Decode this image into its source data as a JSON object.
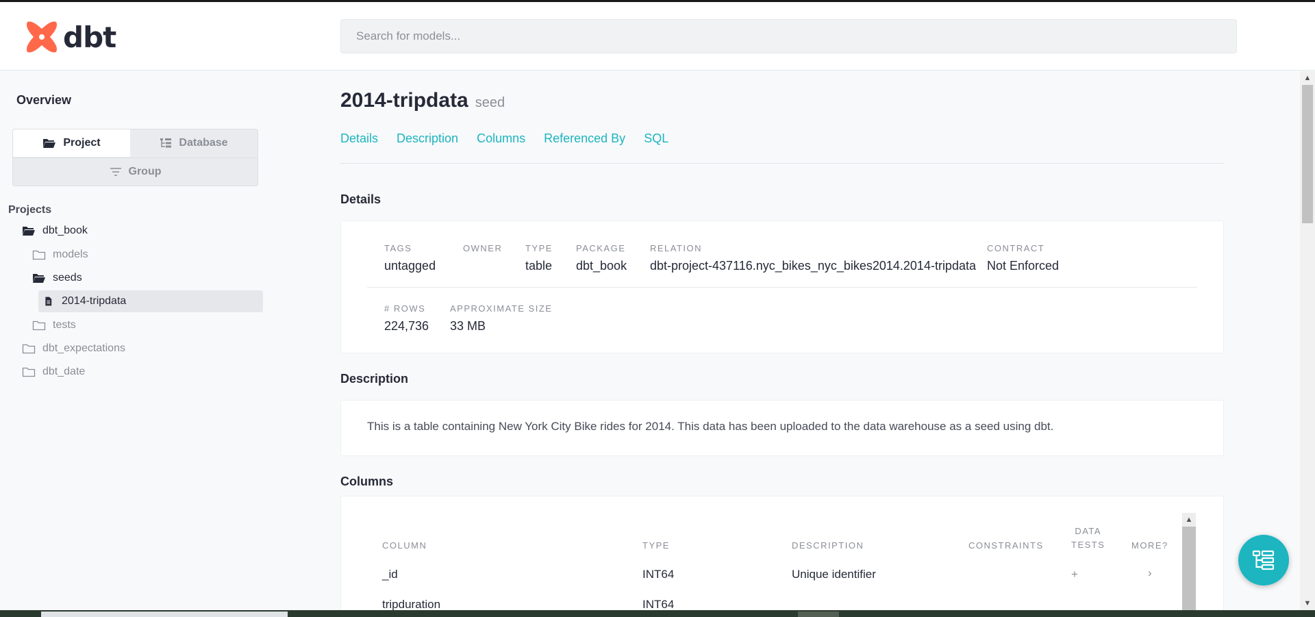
{
  "header": {
    "logo_text": "dbt",
    "search_placeholder": "Search for models..."
  },
  "sidebar": {
    "overview_label": "Overview",
    "segment": {
      "project_label": "Project",
      "database_label": "Database",
      "group_label": "Group"
    },
    "projects_label": "Projects",
    "tree": [
      {
        "label": "dbt_book",
        "level": 0,
        "state": "open"
      },
      {
        "label": "models",
        "level": 1,
        "state": "closed"
      },
      {
        "label": "seeds",
        "level": 1,
        "state": "open"
      },
      {
        "label": "2014-tripdata",
        "level": 2,
        "state": "file-active"
      },
      {
        "label": "tests",
        "level": 1,
        "state": "closed"
      },
      {
        "label": "dbt_expectations",
        "level": 0,
        "state": "closed"
      },
      {
        "label": "dbt_date",
        "level": 0,
        "state": "closed"
      }
    ]
  },
  "main": {
    "title": "2014-tripdata",
    "subtitle": "seed",
    "tabs": [
      "Details",
      "Description",
      "Columns",
      "Referenced By",
      "SQL"
    ],
    "details": {
      "heading": "Details",
      "tags_label": "TAGS",
      "tags_value": "untagged",
      "owner_label": "OWNER",
      "owner_value": "",
      "type_label": "TYPE",
      "type_value": "table",
      "package_label": "PACKAGE",
      "package_value": "dbt_book",
      "relation_label": "RELATION",
      "relation_value": "dbt-project-437116.nyc_bikes_nyc_bikes2014.2014-tripdata",
      "contract_label": "CONTRACT",
      "contract_value": "Not Enforced",
      "rows_label": "# ROWS",
      "rows_value": "224,736",
      "size_label": "APPROXIMATE SIZE",
      "size_value": "33 MB"
    },
    "description": {
      "heading": "Description",
      "text": "This is a table containing New York City Bike rides for 2014. This data has been uploaded to the data warehouse as a seed using dbt."
    },
    "columns": {
      "heading": "Columns",
      "headers": {
        "column": "COLUMN",
        "type": "TYPE",
        "description": "DESCRIPTION",
        "constraints": "CONSTRAINTS",
        "data_tests_1": "DATA",
        "data_tests_2": "TESTS",
        "more": "MORE?"
      },
      "rows": [
        {
          "column": "_id",
          "type": "INT64",
          "description": "Unique identifier",
          "tests": "+",
          "more": "›"
        },
        {
          "column": "tripduration",
          "type": "INT64",
          "description": "",
          "tests": "",
          "more": ""
        }
      ]
    }
  },
  "colors": {
    "accent": "#1cb5c0",
    "logo": "#ff694a",
    "text": "#262a38",
    "muted": "#8a8e96"
  }
}
